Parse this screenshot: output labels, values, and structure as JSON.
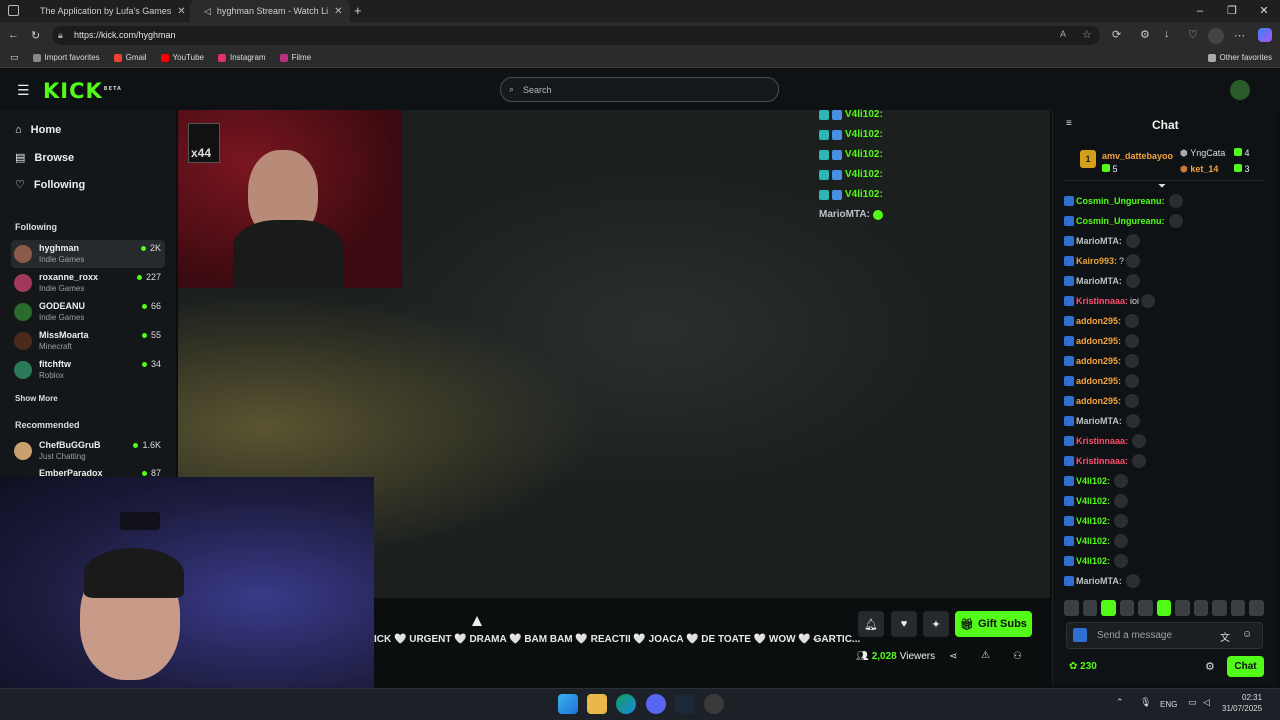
{
  "browser": {
    "tabs": [
      {
        "title": "The Application by Lufa's Games"
      },
      {
        "title": "hyghman Stream - Watch Li"
      }
    ],
    "url": "https://kick.com/hyghman",
    "bookmarks": [
      "Import favorites",
      "Gmail",
      "YouTube",
      "Instagram",
      "Filme"
    ],
    "other_favorites": "Other favorites"
  },
  "header": {
    "logo": "KICK",
    "logo_tag": "BETA",
    "search_placeholder": "Search"
  },
  "sidebar": {
    "nav": [
      "Home",
      "Browse",
      "Following"
    ],
    "following_heading": "Following",
    "following": [
      {
        "name": "hyghman",
        "category": "Indie Games",
        "viewers": "2K",
        "color": "#8a5a4a"
      },
      {
        "name": "roxanne_roxx",
        "category": "Indie Games",
        "viewers": "227",
        "color": "#a13a5a"
      },
      {
        "name": "GODEANU",
        "category": "Indie Games",
        "viewers": "66",
        "color": "#2a6a2a"
      },
      {
        "name": "MissMoarta",
        "category": "Minecraft",
        "viewers": "55",
        "color": "#4a2a1a"
      },
      {
        "name": "fitchftw",
        "category": "Roblox",
        "viewers": "34",
        "color": "#2a7a5a"
      }
    ],
    "show_more": "Show More",
    "recommended_heading": "Recommended",
    "recommended": [
      {
        "name": "ChefBuGGruB",
        "category": "Just Chatting",
        "viewers": "1.6K",
        "color": "#c9a070"
      },
      {
        "name": "EmberParadox",
        "category": "",
        "viewers": "87",
        "color": "#7a3a2a"
      }
    ]
  },
  "video": {
    "cam_badge": "x44",
    "overlay_chat": [
      {
        "user": "V4li102:",
        "text": ""
      },
      {
        "user": "V4li102:",
        "text": ""
      },
      {
        "user": "V4li102:",
        "text": ""
      },
      {
        "user": "V4li102:",
        "text": ""
      },
      {
        "user": "V4li102:",
        "text": ""
      },
      {
        "user": "MarioMTA:",
        "text": ""
      }
    ]
  },
  "stream": {
    "ticker": "ICK 🤍 URGENT 🤍 DRAMA 🤍 BAM BAM 🤍 REACTII 🤍 JOACA 🤍 DE TOATE 🤍 WOW 🤍 GARTIC...",
    "gift_label": "Gift Subs",
    "viewer_count": "2,028",
    "viewer_label": "Viewers"
  },
  "chat": {
    "title": "Chat",
    "pinned": {
      "first": {
        "rank": "1",
        "name": "amv_dattebayoo",
        "count": "5"
      },
      "second": {
        "name": "YngCata",
        "count": "4"
      },
      "third": {
        "name": "ket_14",
        "count": "3"
      }
    },
    "messages": [
      {
        "user": "Cosmin_Ungureanu:",
        "text": "",
        "color": "#53fc18"
      },
      {
        "user": "Cosmin_Ungureanu:",
        "text": "",
        "color": "#53fc18"
      },
      {
        "user": "MarioMTA:",
        "text": "",
        "color": "#b9c3c8"
      },
      {
        "user": "Kairo993:",
        "text": "?",
        "color": "#e8a53a"
      },
      {
        "user": "MarioMTA:",
        "text": "",
        "color": "#b9c3c8"
      },
      {
        "user": "Kristinnaaa:",
        "text": "ioi",
        "color": "#ff4d6d"
      },
      {
        "user": "addon295:",
        "text": "",
        "color": "#f4a340"
      },
      {
        "user": "addon295:",
        "text": "",
        "color": "#f4a340"
      },
      {
        "user": "addon295:",
        "text": "",
        "color": "#f4a340"
      },
      {
        "user": "addon295:",
        "text": "",
        "color": "#f4a340"
      },
      {
        "user": "addon295:",
        "text": "",
        "color": "#f4a340"
      },
      {
        "user": "MarioMTA:",
        "text": "",
        "color": "#b9c3c8"
      },
      {
        "user": "Kristinnaaa:",
        "text": "",
        "color": "#ff4d6d"
      },
      {
        "user": "Kristinnaaa:",
        "text": "",
        "color": "#ff4d6d"
      },
      {
        "user": "V4li102:",
        "text": "",
        "color": "#53fc18"
      },
      {
        "user": "V4li102:",
        "text": "",
        "color": "#53fc18"
      },
      {
        "user": "V4li102:",
        "text": "",
        "color": "#53fc18"
      },
      {
        "user": "V4li102:",
        "text": "",
        "color": "#53fc18"
      },
      {
        "user": "V4li102:",
        "text": "",
        "color": "#53fc18"
      },
      {
        "user": "MarioMTA:",
        "text": "",
        "color": "#b9c3c8"
      }
    ],
    "input_placeholder": "Send a message",
    "points": "230",
    "send_label": "Chat"
  },
  "taskbar": {
    "lang": "ENG",
    "time": "02:31",
    "date": "31/07/2025"
  },
  "colors": {
    "accent": "#53fc18",
    "background": "#0b0e0f"
  }
}
